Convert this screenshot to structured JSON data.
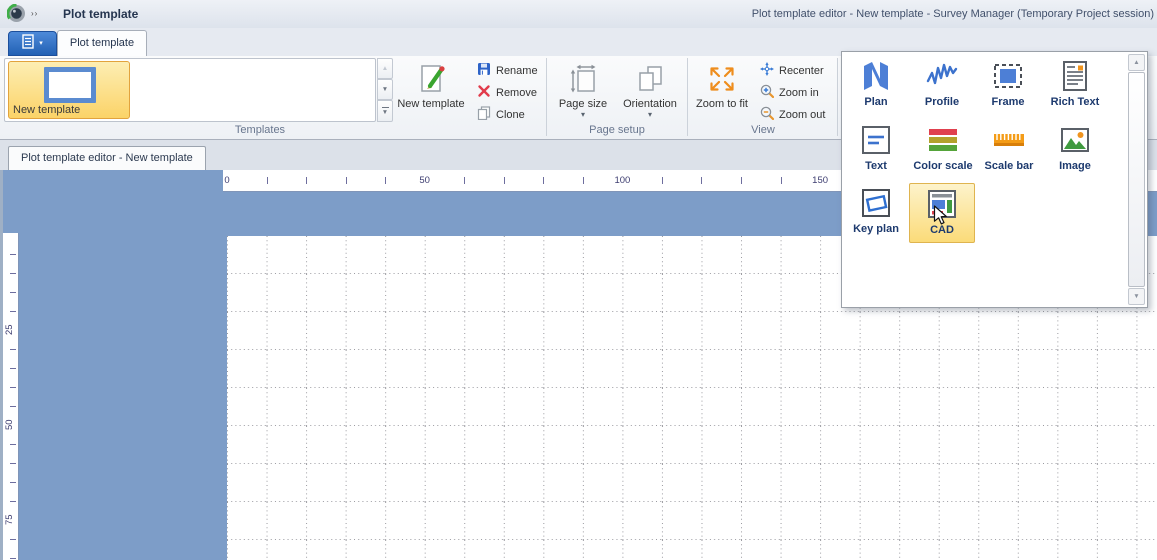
{
  "titlebar": {
    "app_title": "Plot template",
    "window_title": "Plot template editor - New template - Survey Manager (Temporary Project session)",
    "overflow_glyph": "››"
  },
  "tabs": {
    "ribbon_tab": "Plot template",
    "menu_arrow": "▾"
  },
  "ribbon": {
    "groups": {
      "templates": {
        "label": "Templates",
        "gallery": {
          "selected_item": "New template"
        },
        "scroll": {
          "up": "▲",
          "down": "▼",
          "expand": "▼"
        },
        "buttons": {
          "new_template": "New template",
          "rename": "Rename",
          "remove": "Remove",
          "clone": "Clone"
        }
      },
      "page_setup": {
        "label": "Page setup",
        "dropdown_arrow": "▾",
        "buttons": {
          "page_size": "Page size",
          "orientation": "Orientation"
        }
      },
      "view": {
        "label": "View",
        "buttons": {
          "zoom_to_fit": "Zoom to fit",
          "recenter": "Recenter",
          "zoom_in": "Zoom in",
          "zoom_out": "Zoom out"
        }
      }
    }
  },
  "document_tab": "Plot template editor - New template",
  "canvas": {
    "h_ruler_labels": [
      "0",
      "50",
      "100",
      "150"
    ],
    "v_ruler_labels": [
      "25",
      "50",
      "75"
    ]
  },
  "elements_popup": {
    "scroll_up": "▲",
    "scroll_down": "▼",
    "items": [
      {
        "label": "Plan"
      },
      {
        "label": "Profile"
      },
      {
        "label": "Frame"
      },
      {
        "label": "Rich Text"
      },
      {
        "label": "Text"
      },
      {
        "label": "Color scale"
      },
      {
        "label": "Scale bar"
      },
      {
        "label": "Image"
      },
      {
        "label": "Key plan"
      },
      {
        "label": "CAD",
        "selected": true
      }
    ]
  },
  "colors": {
    "canvas_blue": "#7d9dc8",
    "selection_orange": "#fbd368",
    "accent_blue": "#4d7fd6",
    "accent_orange": "#ee8d1d"
  }
}
